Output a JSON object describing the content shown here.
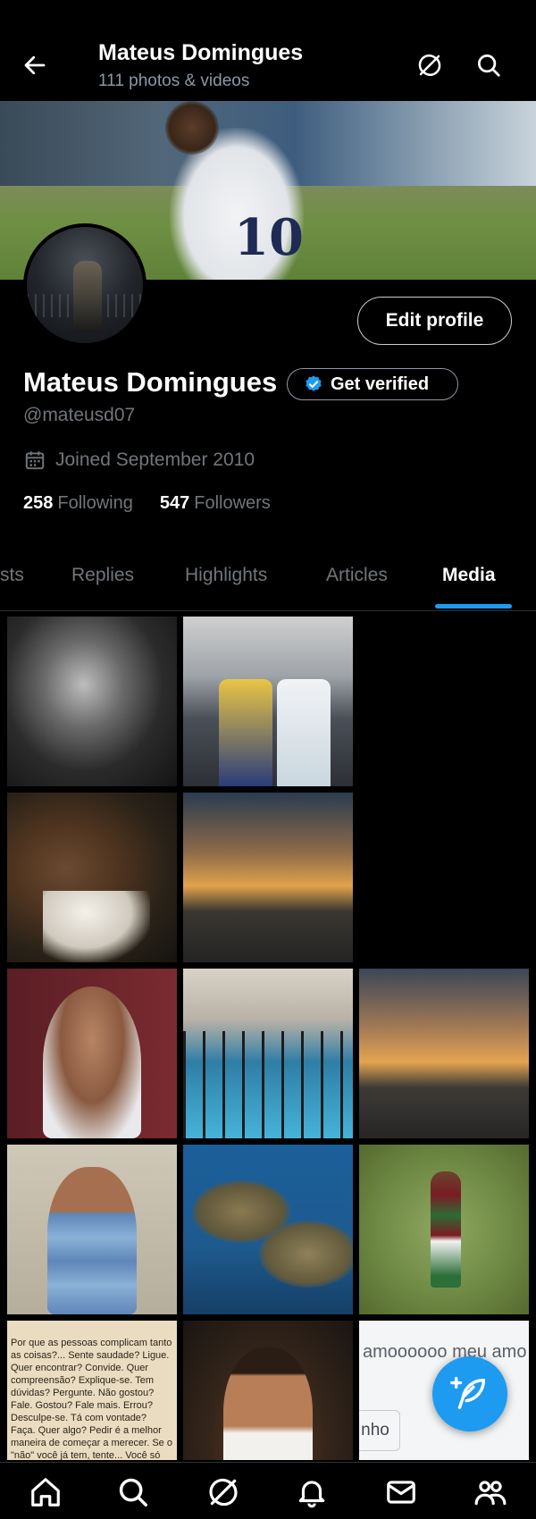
{
  "header": {
    "title": "Mateus Domingues",
    "subtitle": "111 photos & videos",
    "icons": [
      "back-arrow-icon",
      "grok-icon",
      "search-icon"
    ]
  },
  "profile": {
    "name": "Mateus Domingues",
    "handle": "@mateusd07",
    "joined": "Joined September 2010",
    "following_count": "258",
    "following_label": "Following",
    "followers_count": "547",
    "followers_label": "Followers",
    "edit_label": "Edit profile",
    "verify_label": "Get verified"
  },
  "tabs": [
    {
      "label": "sts"
    },
    {
      "label": "Replies"
    },
    {
      "label": "Highlights"
    },
    {
      "label": "Articles"
    },
    {
      "label": "Media",
      "active": true
    }
  ],
  "media": {
    "text_post": "Por que as pessoas complicam tanto as coisas?... Sente saudade? Ligue. Quer encontrar? Convide. Quer compreensão? Explique-se. Tem dúvidas? Pergunte. Não gostou? Fale. Gostou? Fale mais. Errou? Desculpe-se. Tá com vontade? Faça. Quer algo? Pedir é a melhor maneira de começar a merecer. Se o \"não\" você já tem, tente... Você só correrá o risco do \"sim\"... A vida é uma só!!",
    "screenshot_text": "amoooooo meu amo",
    "screenshot_button": "nho"
  },
  "banner": {
    "jersey_number": "10"
  },
  "colors": {
    "accent": "#1d9bf0",
    "background": "#000000",
    "muted": "#71767b"
  },
  "bottom_nav": [
    "home-icon",
    "search-icon",
    "grok-icon",
    "notifications-icon",
    "messages-icon",
    "communities-icon"
  ]
}
